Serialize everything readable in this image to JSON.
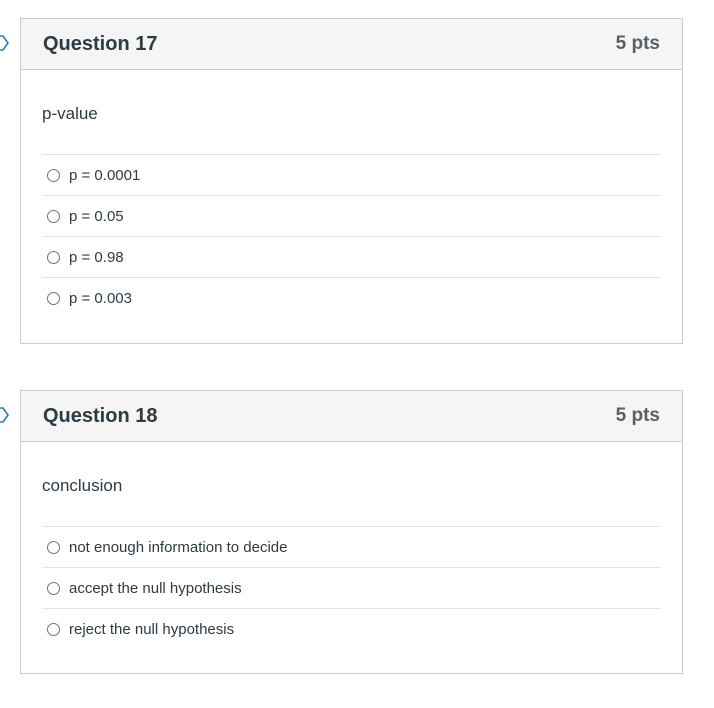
{
  "questions": [
    {
      "title": "Question 17",
      "points": "5 pts",
      "text": "p-value",
      "answers": [
        "p = 0.0001",
        "p = 0.05",
        "p = 0.98",
        "p = 0.003"
      ]
    },
    {
      "title": "Question 18",
      "points": "5 pts",
      "text": "conclusion",
      "answers": [
        "not enough information to decide",
        "accept the null hypothesis",
        "reject the null hypothesis"
      ]
    }
  ],
  "colors": {
    "header_bg": "#f5f5f5",
    "border": "#c7cdd1",
    "text": "#2d3b45",
    "flag": "#2b7abc"
  }
}
